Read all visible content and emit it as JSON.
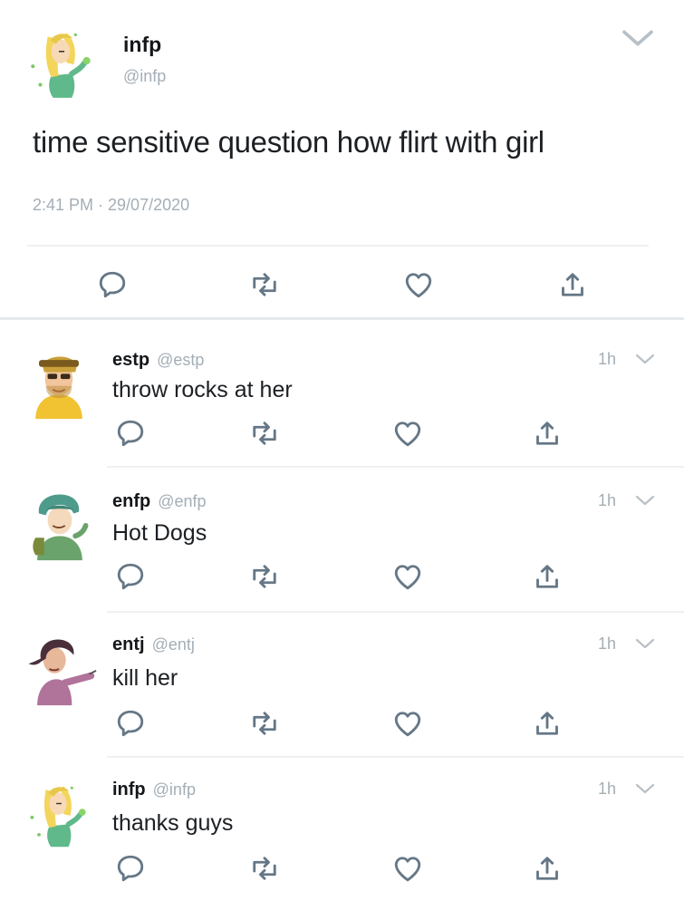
{
  "main": {
    "name": "infp",
    "handle": "@infp",
    "text": "time sensitive question how flirt with girl",
    "timestamp": "2:41 PM · 29/07/2020",
    "actions": [
      "reply-icon",
      "retweet-icon",
      "like-icon",
      "share-icon"
    ]
  },
  "replies": [
    {
      "name": "estp",
      "handle": "@estp",
      "time": "1h",
      "text": "throw rocks at her"
    },
    {
      "name": "enfp",
      "handle": "@enfp",
      "time": "1h",
      "text": "Hot Dogs"
    },
    {
      "name": "entj",
      "handle": "@entj",
      "time": "1h",
      "text": "kill her"
    },
    {
      "name": "infp",
      "handle": "@infp",
      "time": "1h",
      "text": "thanks guys"
    }
  ],
  "colors": {
    "text": "#14171a",
    "muted": "#a4aeb6",
    "icon": "#657786",
    "divider": "#e6e9ec"
  }
}
